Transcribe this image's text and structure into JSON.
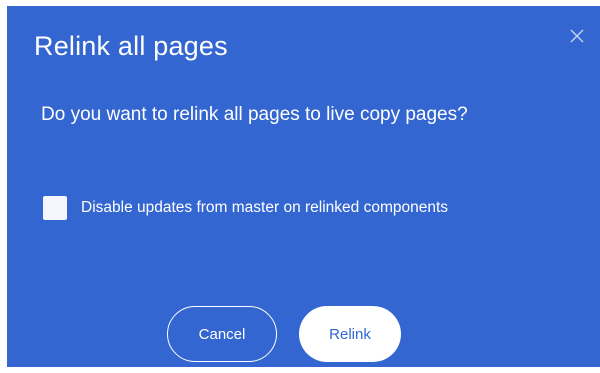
{
  "dialog": {
    "title": "Relink all pages",
    "message": "Do you want to relink all pages to live copy pages?",
    "checkbox": {
      "label": "Disable updates from master on relinked components",
      "checked": false
    },
    "buttons": {
      "cancel_label": "Cancel",
      "relink_label": "Relink"
    },
    "close_icon": "close-icon"
  },
  "colors": {
    "dialog_background": "#3366d0",
    "text": "#ffffff",
    "primary_button_background": "#ffffff",
    "primary_button_text": "#3366d0"
  }
}
